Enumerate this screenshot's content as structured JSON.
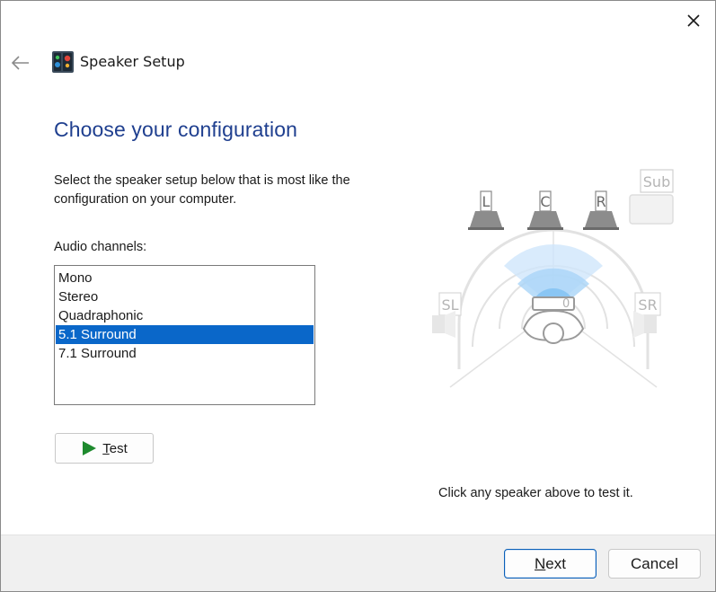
{
  "window": {
    "title": "Speaker Setup"
  },
  "icons": {
    "close": "close-icon",
    "back": "back-arrow-icon",
    "app": "speaker-setup-app-icon",
    "play": "play-icon"
  },
  "page": {
    "heading": "Choose your configuration",
    "instructions": "Select the speaker setup below that is most like the configuration on your computer.",
    "channels_label": "Audio channels:"
  },
  "channels": {
    "items": [
      "Mono",
      "Stereo",
      "Quadraphonic",
      "5.1 Surround",
      "7.1 Surround"
    ],
    "selected": "5.1 Surround"
  },
  "test_button": {
    "prefix": "",
    "accel": "T",
    "rest": "est"
  },
  "speakers": {
    "labels": {
      "left": "L",
      "center": "C",
      "right": "R",
      "sub": "Sub",
      "side_left": "SL",
      "side_right": "SR"
    },
    "hint": "Click any speaker above to test it."
  },
  "footer": {
    "next": {
      "accel": "N",
      "rest": "ext"
    },
    "cancel": "Cancel"
  },
  "colors": {
    "heading": "#1f3f8f",
    "selection": "#0a67c9",
    "play": "#1e8a2e"
  }
}
